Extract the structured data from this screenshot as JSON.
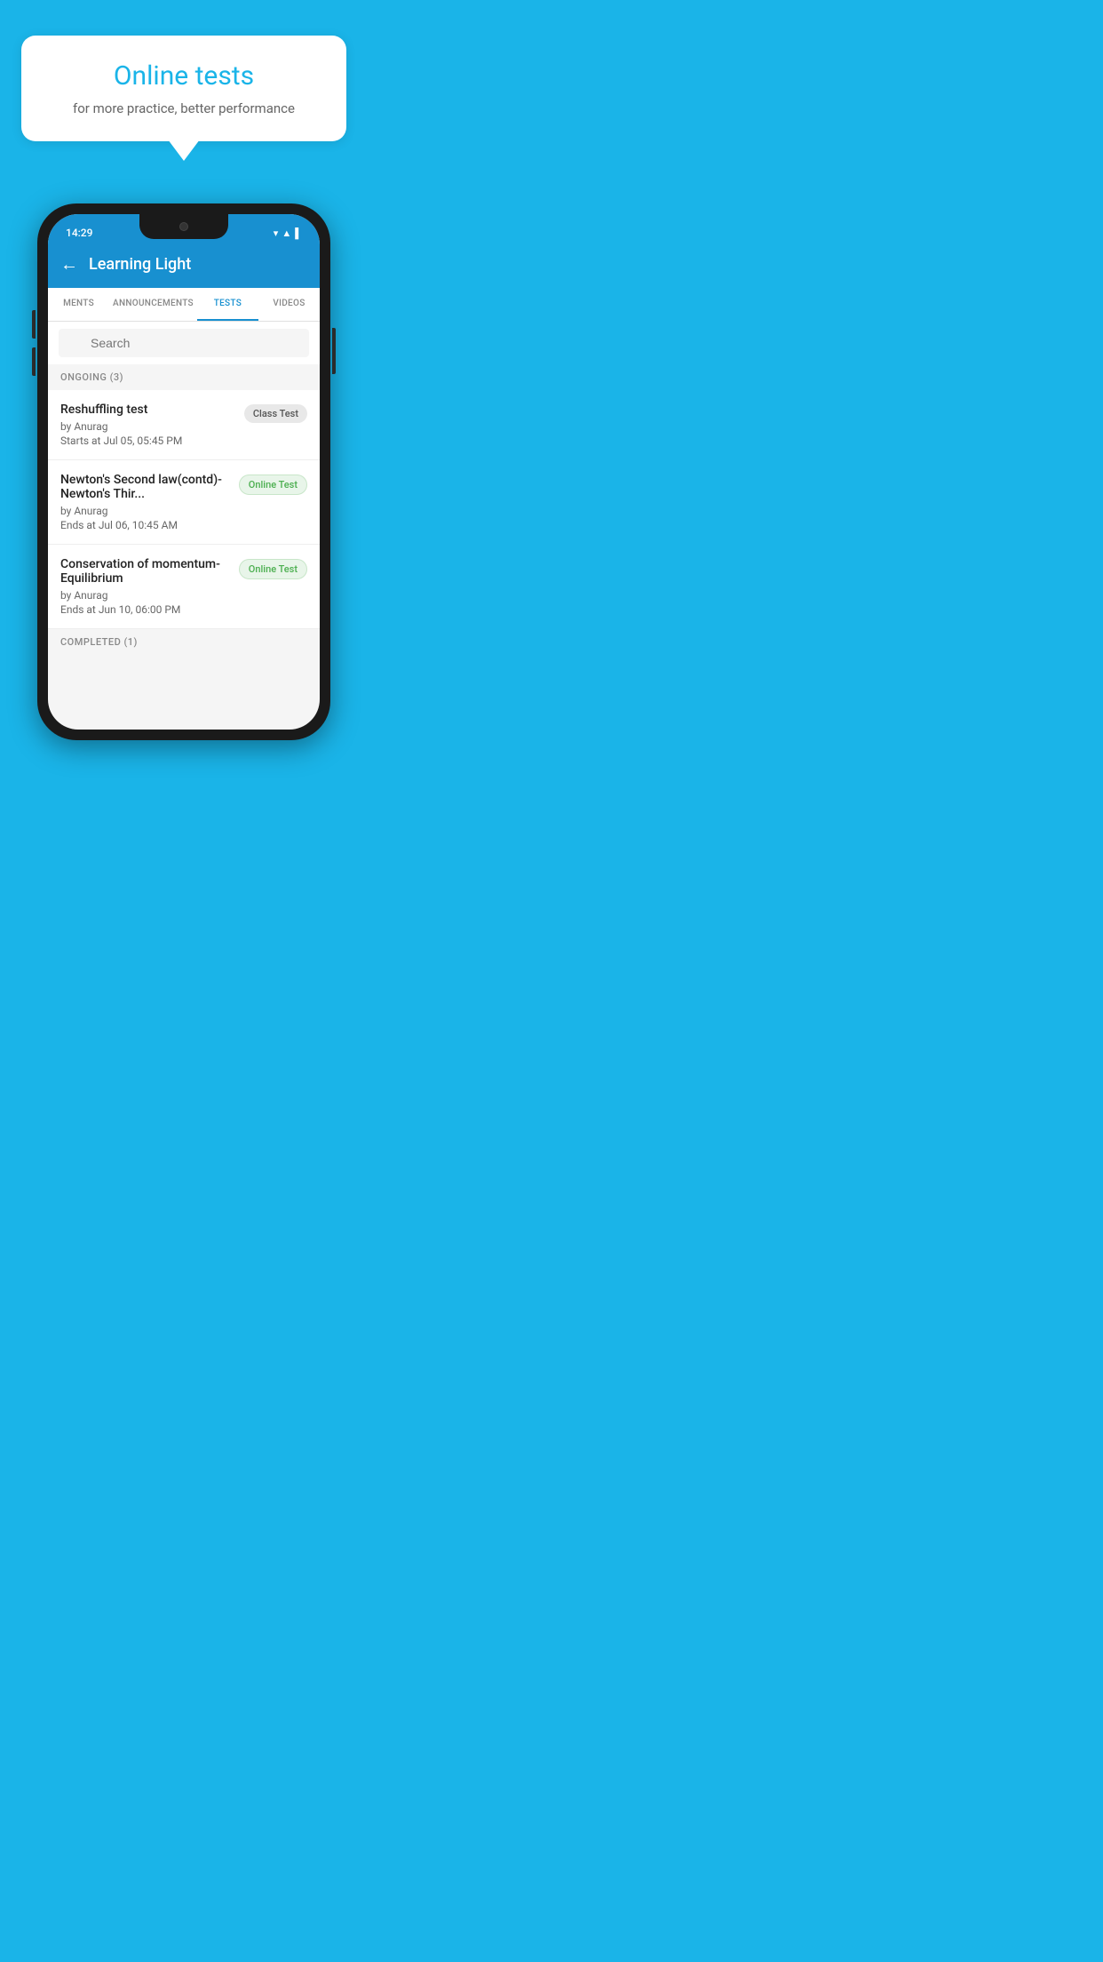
{
  "hero": {
    "title": "Online tests",
    "subtitle": "for more practice, better performance"
  },
  "status_bar": {
    "time": "14:29",
    "icons": [
      "wifi",
      "signal",
      "battery"
    ]
  },
  "app_header": {
    "title": "Learning Light",
    "back_label": "←"
  },
  "tabs": [
    {
      "id": "assignments",
      "label": "MENTS",
      "active": false
    },
    {
      "id": "announcements",
      "label": "ANNOUNCEMENTS",
      "active": false
    },
    {
      "id": "tests",
      "label": "TESTS",
      "active": true
    },
    {
      "id": "videos",
      "label": "VIDEOS",
      "active": false
    }
  ],
  "search": {
    "placeholder": "Search"
  },
  "ongoing_section": {
    "label": "ONGOING (3)"
  },
  "tests": [
    {
      "id": "reshuffling",
      "name": "Reshuffling test",
      "by": "by Anurag",
      "date": "Starts at  Jul 05, 05:45 PM",
      "badge": "Class Test",
      "badge_type": "class"
    },
    {
      "id": "newton",
      "name": "Newton's Second law(contd)-Newton's Thir...",
      "by": "by Anurag",
      "date": "Ends at  Jul 06, 10:45 AM",
      "badge": "Online Test",
      "badge_type": "online"
    },
    {
      "id": "conservation",
      "name": "Conservation of momentum-Equilibrium",
      "by": "by Anurag",
      "date": "Ends at  Jun 10, 06:00 PM",
      "badge": "Online Test",
      "badge_type": "online"
    }
  ],
  "completed_section": {
    "label": "COMPLETED (1)"
  },
  "colors": {
    "primary": "#1890d0",
    "background": "#1ab4e8",
    "badge_class_bg": "#e8e8e8",
    "badge_class_text": "#555",
    "badge_online_bg": "#e8f5e9",
    "badge_online_text": "#4caf50"
  }
}
